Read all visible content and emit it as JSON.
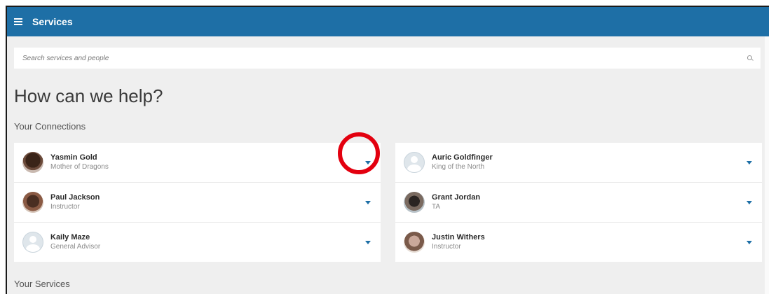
{
  "header": {
    "title": "Services",
    "menu_icon": "hamburger-menu-icon",
    "color": "#1e6fa6"
  },
  "search": {
    "placeholder": "Search services and people",
    "value": "",
    "icon": "search-icon"
  },
  "headline": "How can we help?",
  "connections": {
    "label": "Your Connections",
    "left": [
      {
        "name": "Yasmin Gold",
        "role": "Mother of Dragons",
        "avatar": "photo"
      },
      {
        "name": "Paul Jackson",
        "role": "Instructor",
        "avatar": "photo"
      },
      {
        "name": "Kaily Maze",
        "role": "General Advisor",
        "avatar": "placeholder"
      }
    ],
    "right": [
      {
        "name": "Auric Goldfinger",
        "role": "King of the North",
        "avatar": "placeholder"
      },
      {
        "name": "Grant Jordan",
        "role": "TA",
        "avatar": "photo"
      },
      {
        "name": "Justin Withers",
        "role": "Instructor",
        "avatar": "photo"
      }
    ],
    "expand_icon": "chevron-down-icon"
  },
  "services": {
    "label": "Your Services"
  },
  "annotation": {
    "type": "highlight-ring",
    "color": "#e3000f"
  }
}
